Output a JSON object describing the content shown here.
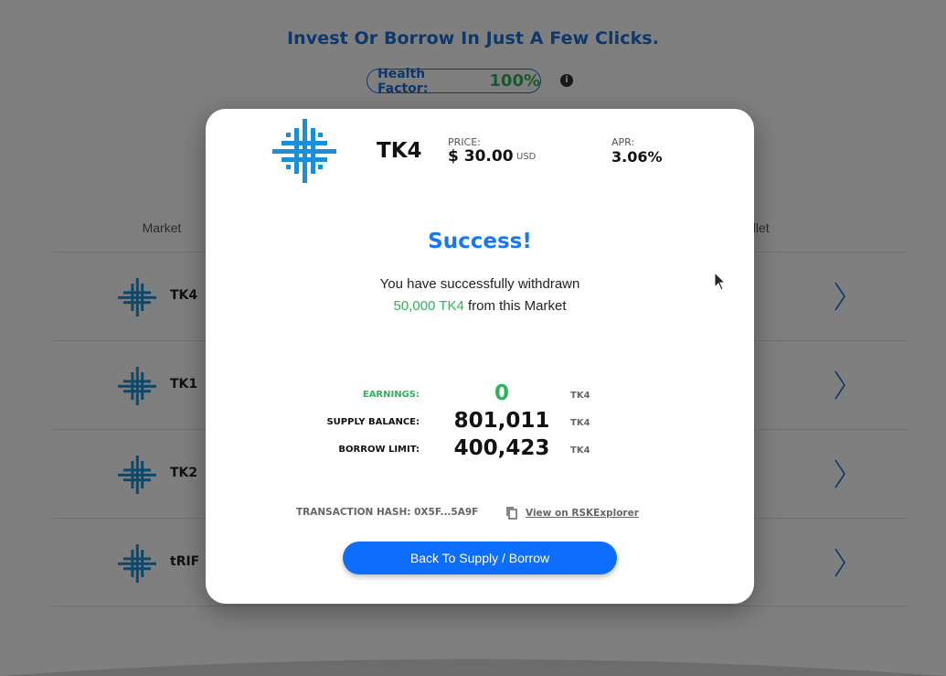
{
  "page": {
    "headline": "Invest Or Borrow In Just A Few Clicks.",
    "health_label": "Health Factor:",
    "health_value": "100%",
    "info_icon": "info-icon"
  },
  "table": {
    "col_market": "Market",
    "col_wallet": "allet",
    "rows": [
      {
        "name": "TK4"
      },
      {
        "name": "TK1"
      },
      {
        "name": "TK2"
      },
      {
        "name": "tRIF"
      }
    ]
  },
  "modal": {
    "token": "TK4",
    "price_label": "PRICE:",
    "price": "$ 30.00",
    "price_unit": "USD",
    "apr_label": "APR:",
    "apr": "3.06%",
    "title": "Success!",
    "message_line1": "You have successfully withdrawn",
    "message_amount": "50,000 TK4",
    "message_rest": " from this Market",
    "stats": {
      "earnings_label": "EARNINGS:",
      "earnings_value": "0",
      "earnings_unit": "TK4",
      "supply_label": "SUPPLY BALANCE:",
      "supply_value": "801,011",
      "supply_unit": "TK4",
      "borrow_label": "BORROW LIMIT:",
      "borrow_value": "400,423",
      "borrow_unit": "TK4"
    },
    "tx_hash": "TRANSACTION HASH: 0X5F...5A9F",
    "view_link": "View on RSKExplorer",
    "back_button": "Back To Supply / Borrow"
  },
  "colors": {
    "accent": "#1877f2",
    "button": "#0d6efd",
    "success_green": "#2fb35a",
    "headline_blue": "#1d6fd8"
  }
}
